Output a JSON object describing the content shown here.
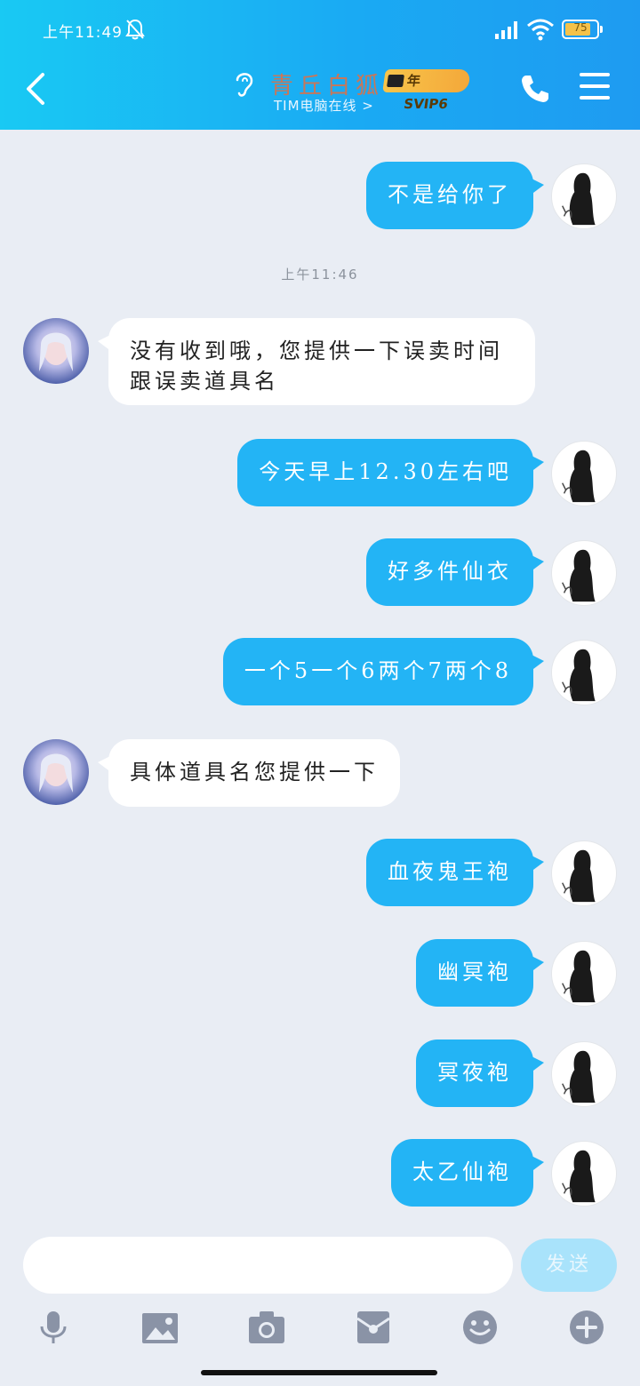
{
  "status_bar": {
    "time": "上午11:49",
    "battery_level": "75"
  },
  "header": {
    "contact_name": "青丘白狐",
    "svip_label": "年SVIP6",
    "sub_status": "TIM电脑在线 >"
  },
  "colors": {
    "header_accent": "#1aaaf3",
    "self_bubble": "#23b4f5",
    "other_bubble": "#ffffff",
    "background": "#e9edf4"
  },
  "timestamp": "上午11:46",
  "messages": [
    {
      "from": "self",
      "text": "不是给你了"
    },
    {
      "from": "other",
      "text": "没有收到哦，您提供一下误卖时间跟误卖道具名"
    },
    {
      "from": "self",
      "text": "今天早上12.30左右吧"
    },
    {
      "from": "self",
      "text": "好多件仙衣"
    },
    {
      "from": "self",
      "text": "一个5一个6两个7两个8"
    },
    {
      "from": "other",
      "text": "具体道具名您提供一下"
    },
    {
      "from": "self",
      "text": "血夜鬼王袍"
    },
    {
      "from": "self",
      "text": "幽冥袍"
    },
    {
      "from": "self",
      "text": "冥夜袍"
    },
    {
      "from": "self",
      "text": "太乙仙袍"
    }
  ],
  "input": {
    "placeholder": "",
    "send_label": "发送"
  },
  "toolbar": {
    "icons": [
      "microphone-icon",
      "image-icon",
      "camera-icon",
      "red-packet-icon",
      "emoji-icon",
      "plus-icon"
    ]
  }
}
